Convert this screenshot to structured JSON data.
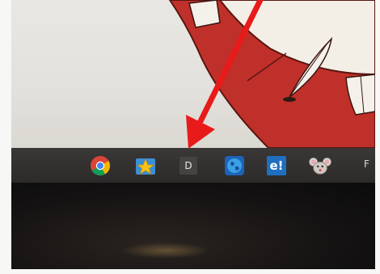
{
  "taskbar": {
    "items": [
      {
        "icon": "chrome-icon",
        "label": ""
      },
      {
        "icon": "star-folder-icon",
        "label": ""
      },
      {
        "icon": "d-app-icon",
        "label": "D"
      },
      {
        "icon": "globe-icon",
        "label": ""
      },
      {
        "icon": "e-app-icon",
        "label": "e!"
      },
      {
        "icon": "mouse-mascot-icon",
        "label": ""
      },
      {
        "icon": "f-app-icon",
        "label": "F"
      }
    ]
  },
  "annotation": {
    "icon": "red-arrow-icon",
    "color": "#e81a1a",
    "points_to": "d-app-icon"
  },
  "colors": {
    "taskbar": "#2f2c2c",
    "wallpaper_red": "#c0302a",
    "wallpaper_cream": "#f3efe7",
    "arrow": "#e81a1a"
  }
}
